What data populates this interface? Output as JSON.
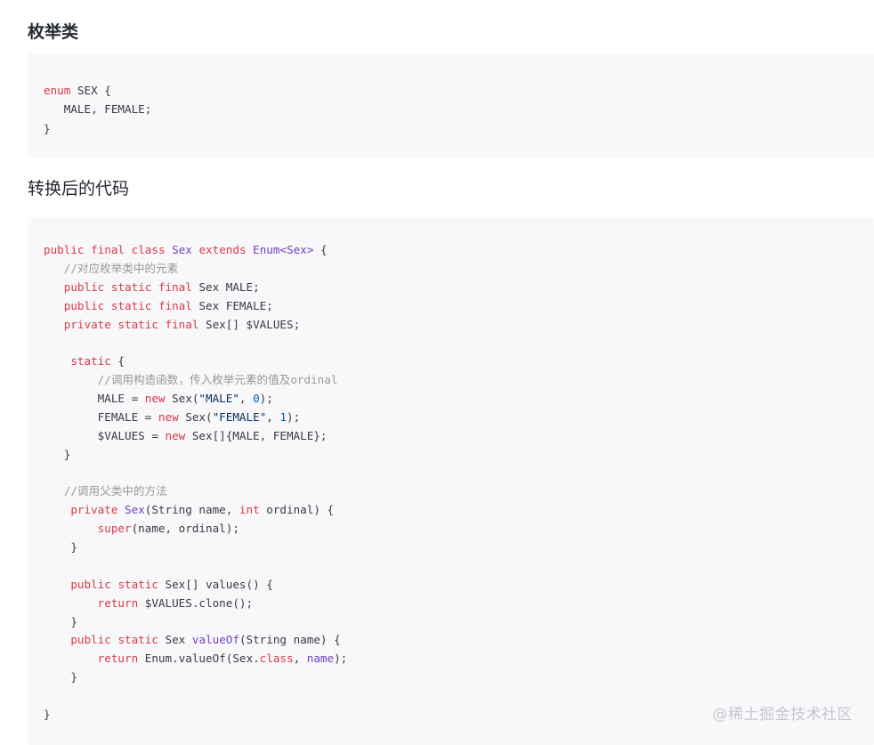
{
  "headings": {
    "enum_class": "枚举类",
    "converted_code": "转换后的代码"
  },
  "code_blocks": [
    {
      "language": "java",
      "lines": [
        "enum SEX {",
        "   MALE, FEMALE;",
        "}"
      ]
    },
    {
      "language": "java",
      "lines": [
        "public final class Sex extends Enum<Sex> {",
        "   //对应枚举类中的元素",
        "   public static final Sex MALE;",
        "   public static final Sex FEMALE;",
        "   private static final Sex[] $VALUES;",
        "",
        "    static {",
        "        //调用构造函数，传入枚举元素的值及ordinal",
        "        MALE = new Sex(\"MALE\", 0);",
        "        FEMALE = new Sex(\"FEMALE\", 1);",
        "        $VALUES = new Sex[]{MALE, FEMALE};",
        "   }",
        "",
        "   //调用父类中的方法",
        "    private Sex(String name, int ordinal) {",
        "        super(name, ordinal);",
        "    }",
        "",
        "    public static Sex[] values() {",
        "        return $VALUES.clone();",
        "    }",
        "    public static Sex valueOf(String name) {",
        "        return Enum.valueOf(Sex.class, name);",
        "    }",
        "",
        "}"
      ]
    }
  ],
  "watermark": "@稀土掘金技术社区",
  "colors": {
    "code_background": "#f8f8fa",
    "keyword": "#d73a49",
    "comment": "#999999",
    "string": "#032f62",
    "number": "#005cc5",
    "type_name": "#6f42c1",
    "plain_text": "#383a42",
    "heading_text": "#252933",
    "watermark": "#c4c7cc"
  }
}
